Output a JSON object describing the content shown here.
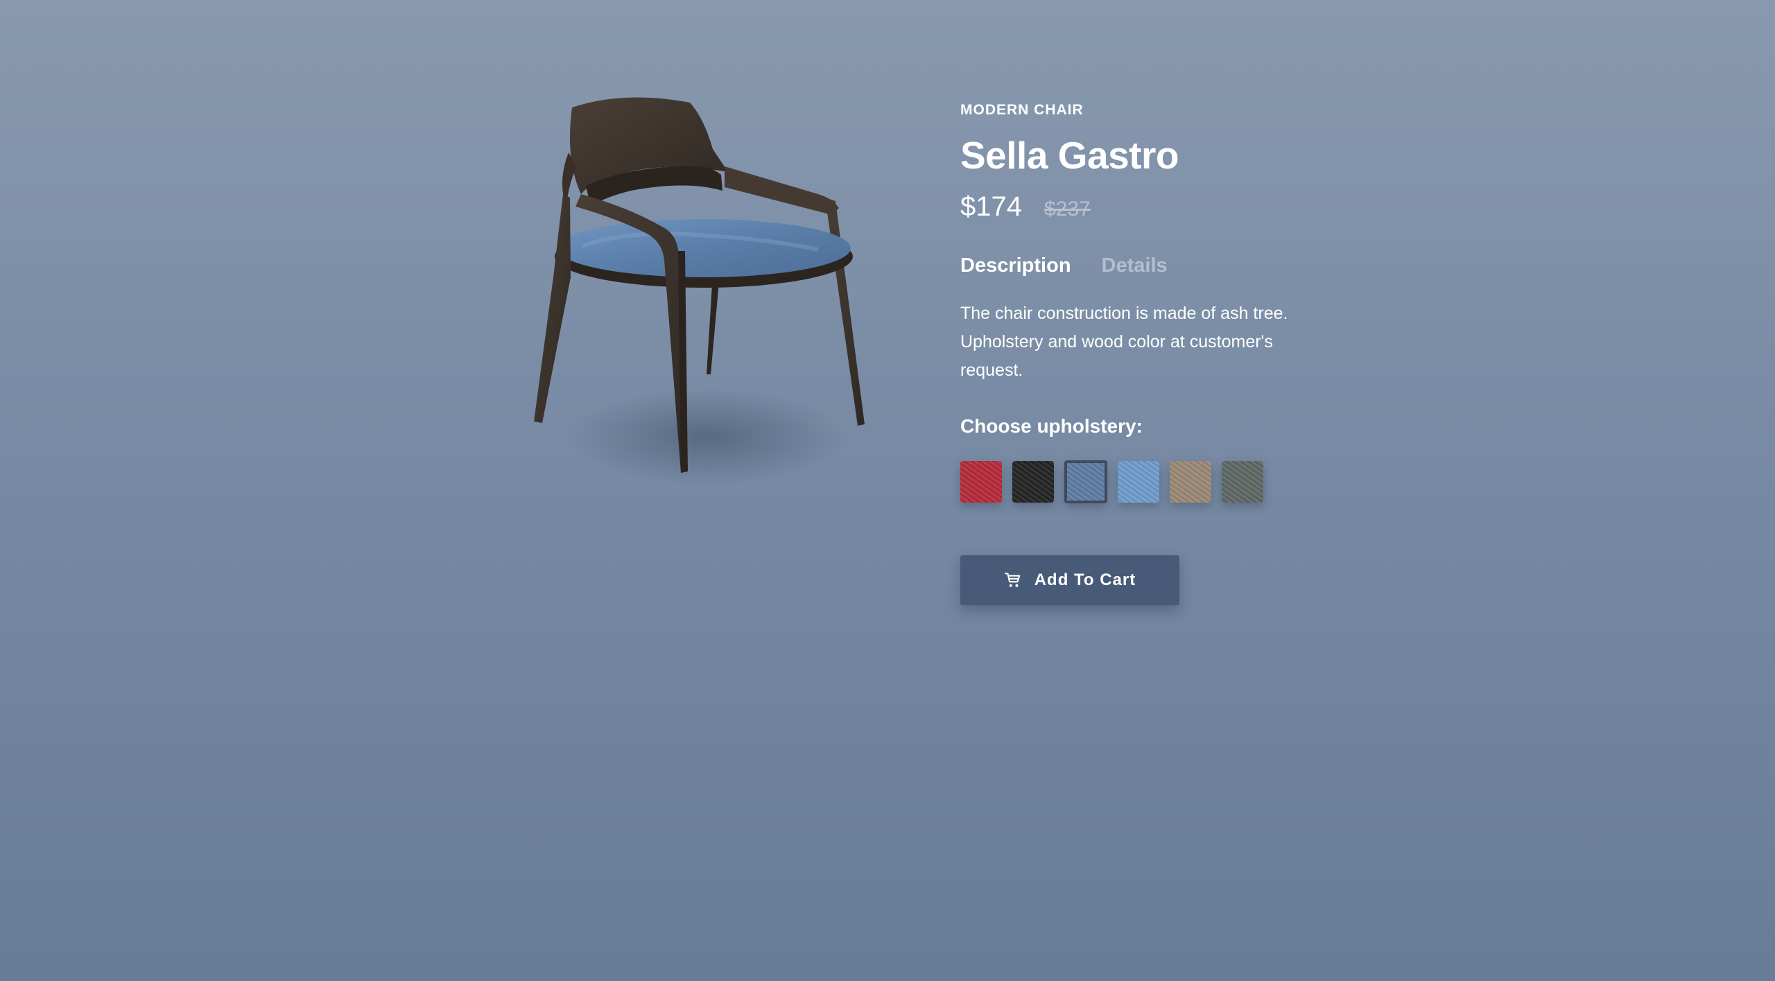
{
  "product": {
    "category": "MODERN CHAIR",
    "name": "Sella Gastro",
    "price": "$174",
    "old_price": "$237",
    "image_icon": "chair-image"
  },
  "tabs": [
    {
      "label": "Description",
      "active": true
    },
    {
      "label": "Details",
      "active": false
    }
  ],
  "description": "The chair construction is made of ash tree. Upholstery and wood color at customer's request.",
  "upholstery": {
    "label": "Choose upholstery:",
    "swatches": [
      {
        "color": "#b52b3a",
        "selected": false
      },
      {
        "color": "#242424",
        "selected": false
      },
      {
        "color": "#5f7ca3",
        "selected": true
      },
      {
        "color": "#6f9bcb",
        "selected": false
      },
      {
        "color": "#9a8875",
        "selected": false
      },
      {
        "color": "#5e6763",
        "selected": false
      }
    ]
  },
  "cart": {
    "label": "Add To Cart",
    "icon": "cart-icon"
  },
  "colors": {
    "background_top": "#8899af",
    "background_bottom": "#677c97",
    "button": "#475a78",
    "wood": "#3e342d",
    "seat": "#5c7fa8"
  }
}
